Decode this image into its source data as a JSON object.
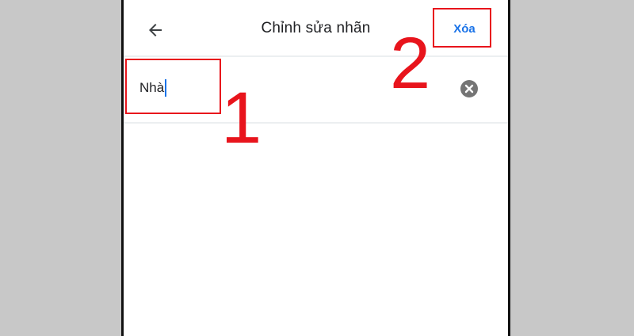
{
  "app_bar": {
    "back_icon": "arrow-left-icon",
    "title": "Chỉnh sửa nhãn",
    "delete_label": "Xóa"
  },
  "label_field": {
    "value": "Nhà",
    "clear_icon": "clear-circle-icon"
  },
  "annotations": {
    "step_1": "1",
    "step_2": "2"
  },
  "colors": {
    "accent": "#1a73e8",
    "annotation_red": "#e8141c",
    "background_gray": "#c8c8c8"
  }
}
